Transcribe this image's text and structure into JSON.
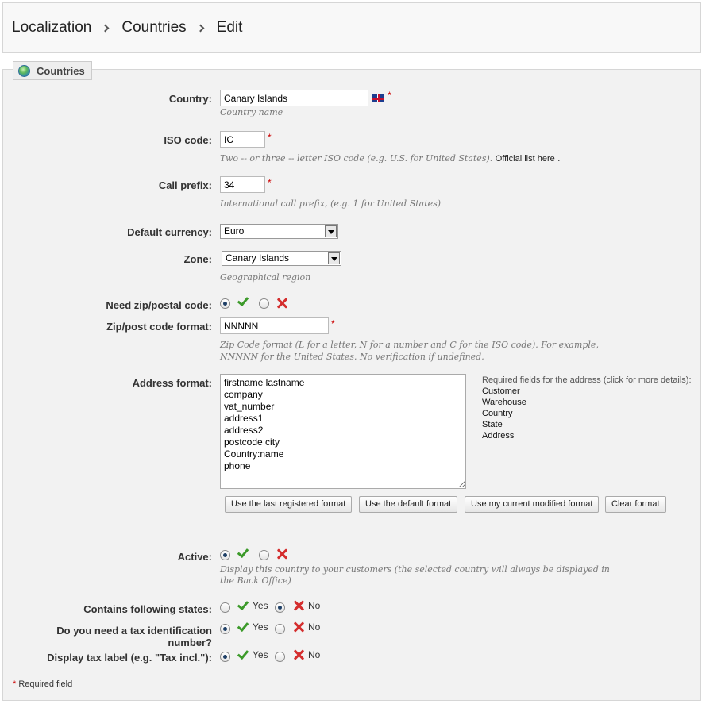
{
  "breadcrumb": [
    "Localization",
    "Countries",
    "Edit"
  ],
  "panel": {
    "title": "Countries"
  },
  "country": {
    "label": "Country:",
    "value": "Canary Islands",
    "help": "Country name",
    "required": "*"
  },
  "iso": {
    "label": "ISO code:",
    "value": "IC",
    "required": "*",
    "help": "Two -- or three -- letter ISO code (e.g. U.S. for United States).",
    "link": "Official list here",
    "help_end": "."
  },
  "prefix": {
    "label": "Call prefix:",
    "value": "34",
    "required": "*",
    "help": "International call prefix, (e.g. 1 for United States)"
  },
  "currency": {
    "label": "Default currency:",
    "value": "Euro"
  },
  "zone": {
    "label": "Zone:",
    "value": "Canary Islands",
    "help": "Geographical region"
  },
  "need_zip": {
    "label": "Need zip/postal code:",
    "selected": "yes"
  },
  "zip_format": {
    "label": "Zip/post code format:",
    "value": "NNNNN",
    "required": "*",
    "help_line1": "Zip Code format (L for a letter, N for a number and C for the ISO code). For example,",
    "help_line2": "NNNNN for the United States. No verification if undefined."
  },
  "address": {
    "label": "Address format:",
    "value": "firstname lastname\ncompany\nvat_number\naddress1\naddress2\npostcode city\nCountry:name\nphone",
    "required_title": "Required fields for the address (click for more details):",
    "required_fields": [
      "Customer",
      "Warehouse",
      "Country",
      "State",
      "Address"
    ],
    "buttons": [
      "Use the last registered format",
      "Use the default format",
      "Use my current modified format",
      "Clear format"
    ]
  },
  "active": {
    "label": "Active:",
    "selected": "yes",
    "help_line1": "Display this country to your customers (the selected country will always be displayed in",
    "help_line2": "the Back Office)"
  },
  "states": {
    "label": "Contains following states:",
    "yes": "Yes",
    "no": "No",
    "selected": "no"
  },
  "tax_id": {
    "label_line1": "Do you need a tax identification",
    "label_line2": "number?",
    "yes": "Yes",
    "no": "No",
    "selected": "yes"
  },
  "tax_label": {
    "label": "Display tax label (e.g. \"Tax incl.\"):",
    "yes": "Yes",
    "no": "No",
    "selected": "yes"
  },
  "footnote": {
    "star": "*",
    "text": "Required field"
  },
  "colors": {
    "accent_check": "#3c9a2a",
    "accent_cross": "#d42d2d",
    "required": "#cc0000"
  }
}
